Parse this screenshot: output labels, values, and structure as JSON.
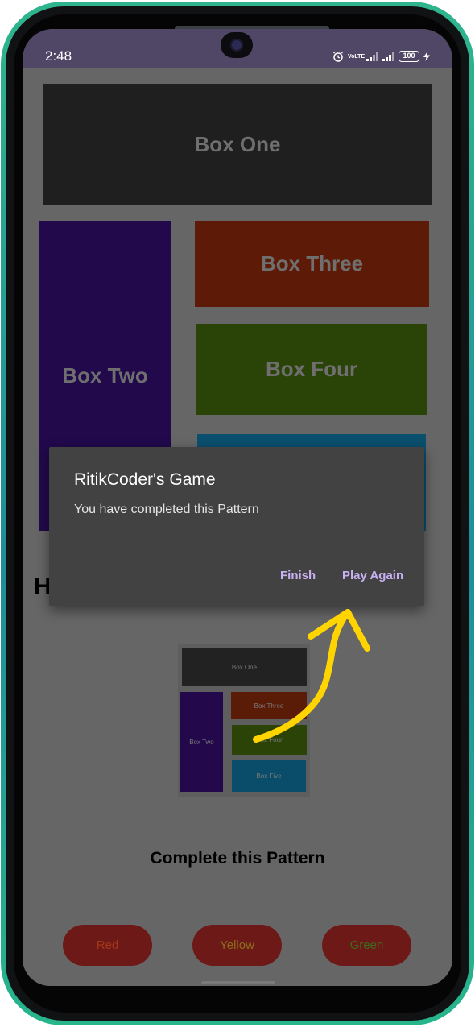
{
  "status_bar": {
    "time": "2:48",
    "volte_label": "VoLTE",
    "battery_level": "100",
    "icons": [
      "alarm-icon",
      "volte-icon",
      "signal-icon",
      "battery-icon",
      "charging-bolt-icon"
    ]
  },
  "game": {
    "boxes": [
      {
        "label": "Box One",
        "color": "#1f1f1f"
      },
      {
        "label": "Box Two",
        "color": "#21094c"
      },
      {
        "label": "Box Three",
        "color": "#5d1a06"
      },
      {
        "label": "Box Four",
        "color": "#2a4307"
      },
      {
        "label": "Box Five",
        "color": "#0a4f6e"
      }
    ],
    "hidden_heading": "H"
  },
  "pattern": {
    "boxes": [
      "Box One",
      "Box Two",
      "Box Three",
      "Box Four",
      "Box Five"
    ],
    "title": "Complete this Pattern"
  },
  "color_buttons": [
    {
      "label": "Red",
      "color": "#a5361a"
    },
    {
      "label": "Yellow",
      "color": "#8c6d1b"
    },
    {
      "label": "Green",
      "color": "#3f6a1c"
    }
  ],
  "dialog": {
    "title": "RitikCoder's Game",
    "message": "You have completed this Pattern",
    "finish_label": "Finish",
    "play_again_label": "Play Again",
    "accent_color": "#c9b0f2"
  },
  "colors": {
    "phone_frame": "#2fb58d",
    "screen_background": "#666666",
    "status_bar": "#4f4765",
    "annotation": "#ffd400"
  }
}
